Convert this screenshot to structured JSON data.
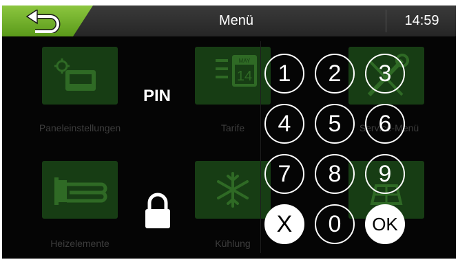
{
  "header": {
    "title": "Menü",
    "time": "14:59",
    "back_icon": "back-arrow-icon",
    "accent_color": "#7ab830"
  },
  "menu": {
    "tiles": [
      {
        "label": "Paneleinstellungen",
        "icon": "panel-settings-icon"
      },
      {
        "label": "Tarife",
        "icon": "calendar-icon",
        "icon_text_month": "MAY",
        "icon_text_day": "14"
      },
      {
        "label": "Service-Menü",
        "icon": "service-tools-icon"
      },
      {
        "label": "Heizelemente",
        "icon": "heating-element-icon"
      },
      {
        "label": "Kühlung",
        "icon": "snowflake-icon"
      },
      {
        "label": "",
        "icon": "solar-panel-icon"
      }
    ]
  },
  "pin": {
    "label": "PIN",
    "lock_icon": "lock-icon",
    "keys": [
      "1",
      "2",
      "3",
      "4",
      "5",
      "6",
      "7",
      "8",
      "9",
      "X",
      "0",
      "OK"
    ]
  }
}
